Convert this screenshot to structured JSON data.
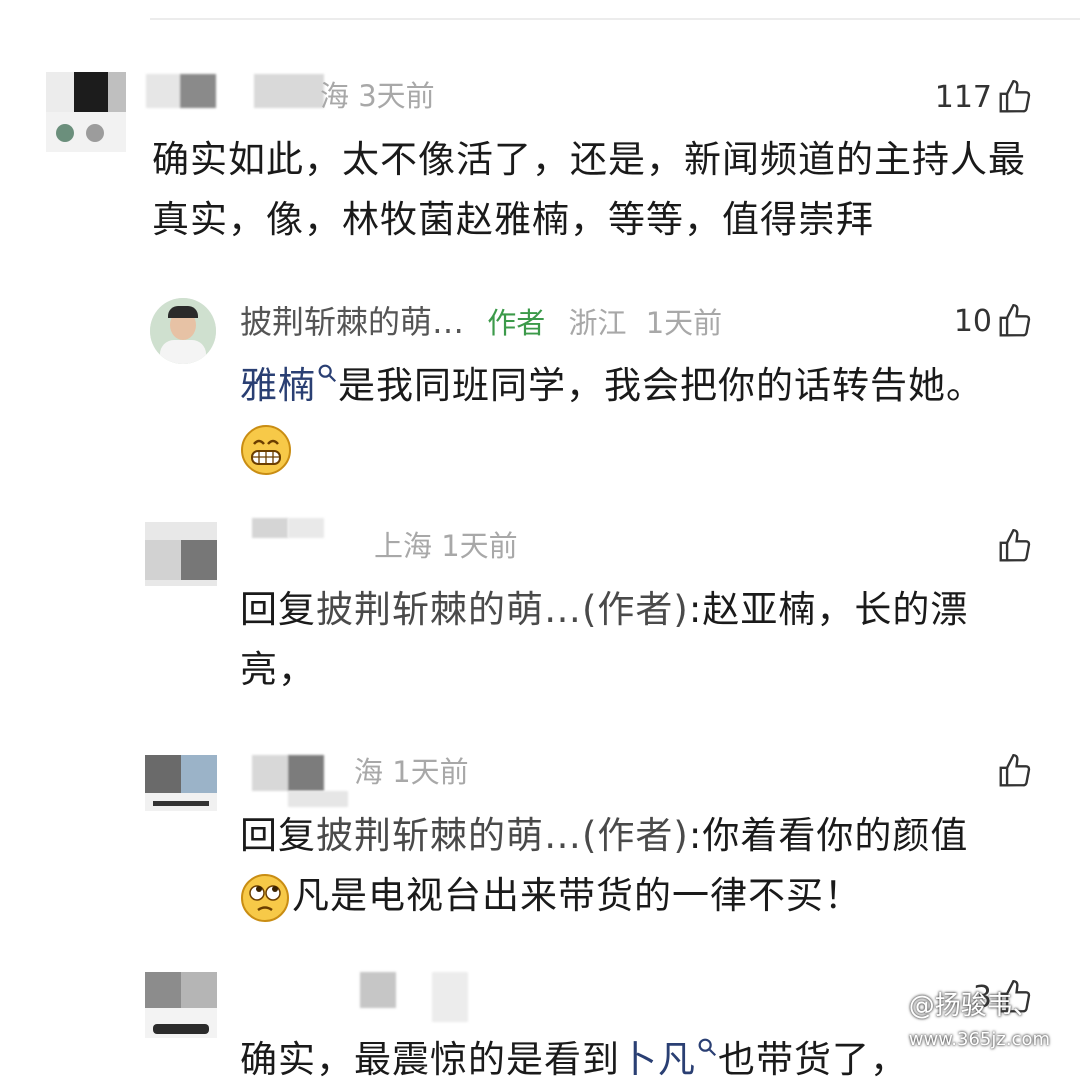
{
  "comments": [
    {
      "meta": {
        "location_time": "海  3天前"
      },
      "likes": "117",
      "text": "确实如此，太不像活了，还是，新闻频道的主持人最真实，像，林牧菌赵雅楠，等等，值得崇拜"
    },
    {
      "meta": {
        "username": "披荆斩棘的萌…",
        "author_tag": "作者",
        "location": "浙江",
        "time": "1天前"
      },
      "likes": "10",
      "link_text": "雅楠",
      "text": "是我同班同学，我会把你的话转告她。"
    },
    {
      "meta": {
        "location_time": "上海  1天前"
      },
      "likes": "",
      "reply_prefix": "回复",
      "reply_to": "披荆斩棘的萌…(作者)",
      "text": ":赵亚楠，长的漂亮，"
    },
    {
      "meta": {
        "location_time": "海  1天前"
      },
      "likes": "",
      "reply_prefix": "回复",
      "reply_to": "披荆斩棘的萌…(作者)",
      "text": ":你着看你的颜值",
      "text2": "凡是电视台出来带货的一律不买！"
    },
    {
      "meta": {
        "location_time": ""
      },
      "likes": "3",
      "text": "确实，最震惊的是看到",
      "link_text": "卜凡",
      "text_after": "也带货了，"
    }
  ],
  "watermark": {
    "text": "@扬骏韦、",
    "url": "www.365jz.com"
  },
  "colors": {
    "author_green": "#3c9a4a",
    "link_blue": "#2a3f73",
    "meta_gray": "#a8a8a8"
  }
}
